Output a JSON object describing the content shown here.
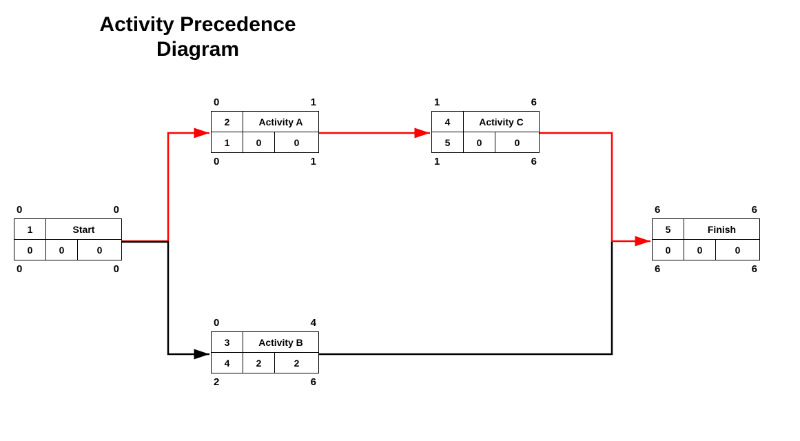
{
  "title": "Activity Precedence Diagram",
  "nodes": {
    "start": {
      "id": "1",
      "name": "Start",
      "es": "0",
      "ef": "0",
      "ls": "0",
      "lf": "0",
      "dur": "0",
      "tf": "0",
      "ff": "0"
    },
    "a": {
      "id": "2",
      "name": "Activity A",
      "es": "0",
      "ef": "1",
      "ls": "0",
      "lf": "1",
      "dur": "1",
      "tf": "0",
      "ff": "0"
    },
    "b": {
      "id": "3",
      "name": "Activity B",
      "es": "0",
      "ef": "4",
      "ls": "2",
      "lf": "6",
      "dur": "4",
      "tf": "2",
      "ff": "2"
    },
    "c": {
      "id": "4",
      "name": "Activity C",
      "es": "1",
      "ef": "6",
      "ls": "1",
      "lf": "6",
      "dur": "5",
      "tf": "0",
      "ff": "0"
    },
    "finish": {
      "id": "5",
      "name": "Finish",
      "es": "6",
      "ef": "6",
      "ls": "6",
      "lf": "6",
      "dur": "0",
      "tf": "0",
      "ff": "0"
    }
  },
  "edges": [
    {
      "kind": "critical",
      "from": "start",
      "to": "a"
    },
    {
      "kind": "critical",
      "from": "a",
      "to": "c"
    },
    {
      "kind": "critical",
      "from": "c",
      "to": "finish"
    },
    {
      "kind": "normal",
      "from": "start",
      "to": "b"
    },
    {
      "kind": "normal",
      "from": "b",
      "to": "finish"
    }
  ],
  "colors": {
    "critical": "#ff0000",
    "normal": "#000000"
  }
}
